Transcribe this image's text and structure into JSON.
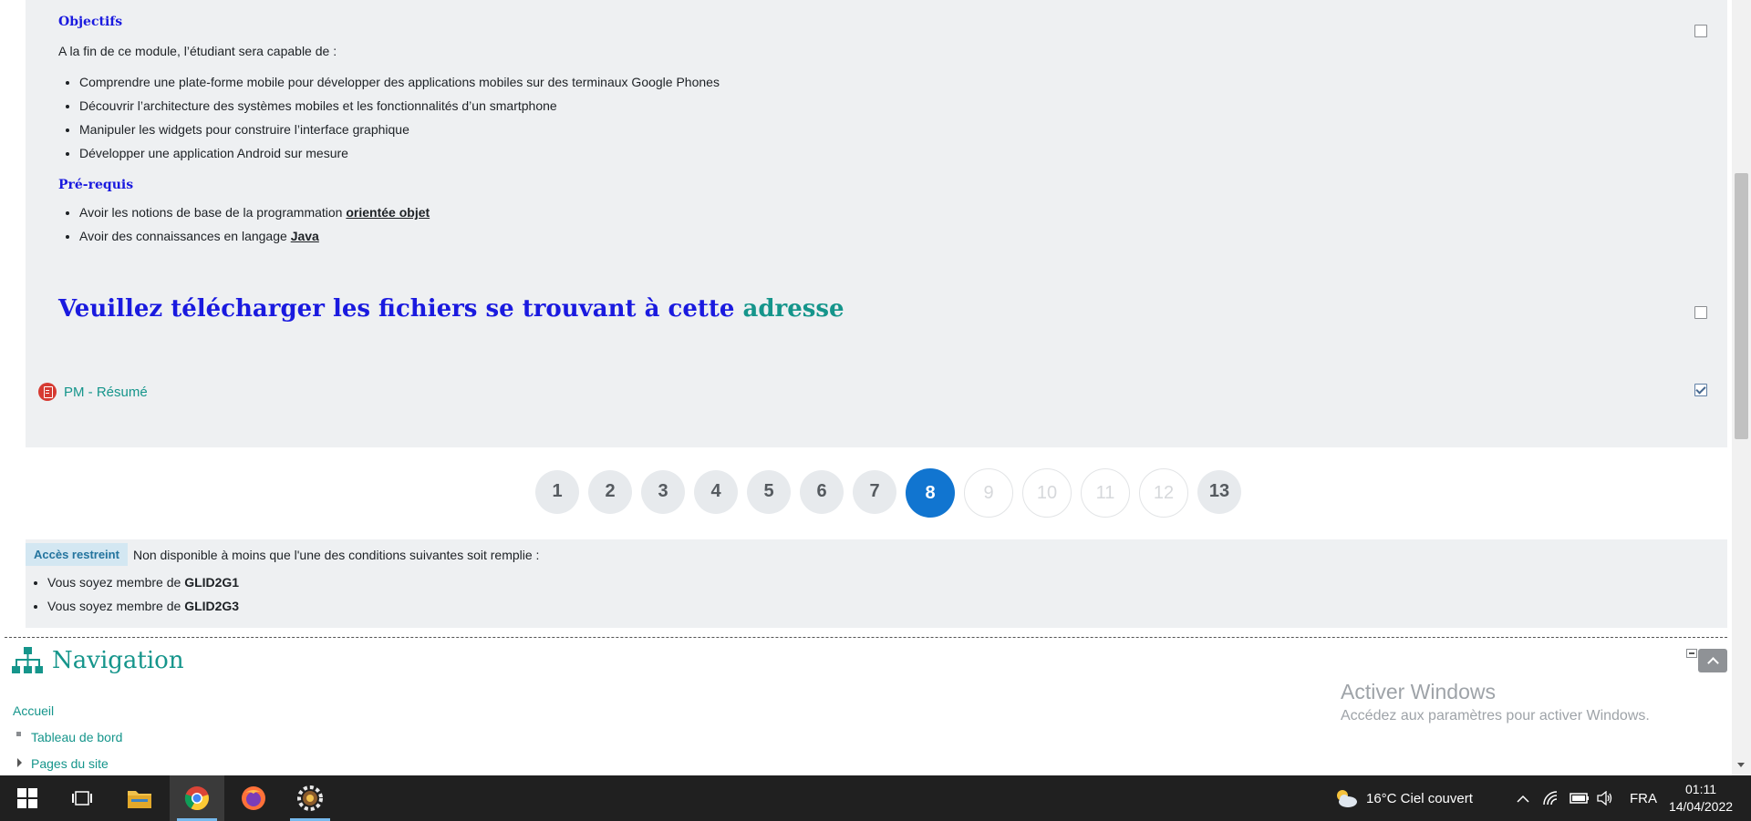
{
  "section": {
    "objectives_title": "Objectifs",
    "intro": "A la fin de ce module, l’étudiant sera capable de :",
    "objectives": [
      "Comprendre une plate-forme mobile pour développer des applications mobiles sur des terminaux Google Phones",
      "Découvrir l’architecture des systèmes mobiles et les fonctionnalités d’un smartphone",
      "Manipuler les widgets pour construire l’interface graphique",
      "Développer une application Android sur mesure"
    ],
    "prereq_title": "Pré-requis",
    "prereq_1_text": "Avoir les notions de base de la programmation ",
    "prereq_1_link": "orientée objet",
    "prereq_2_text": "Avoir des connaissances en langage ",
    "prereq_2_link": "Java",
    "download_text": "Veuillez télécharger les fichiers se trouvant à cette ",
    "download_link": "adresse",
    "resource_label": "PM - Résumé",
    "completion": [
      false,
      false,
      true
    ]
  },
  "pagination": {
    "pages": [
      "1",
      "2",
      "3",
      "4",
      "5",
      "6",
      "7",
      "8",
      "9",
      "10",
      "11",
      "12",
      "13"
    ],
    "current": "8",
    "disabled": [
      "9",
      "10",
      "11",
      "12"
    ]
  },
  "restricted": {
    "badge": "Accès restreint",
    "text": "Non disponible à moins que l'une des conditions suivantes soit remplie :",
    "condition_prefix": "Vous soyez membre de ",
    "groups": [
      "GLID2G1",
      "GLID2G3"
    ]
  },
  "navigation": {
    "title": "Navigation",
    "home": "Accueil",
    "dashboard": "Tableau de bord",
    "site_pages": "Pages du site"
  },
  "watermark": {
    "title": "Activer Windows",
    "subtitle": "Accédez aux paramètres pour activer Windows."
  },
  "taskbar": {
    "weather": "16°C  Ciel couvert",
    "language": "FRA",
    "time": "01:11",
    "date": "14/04/2022"
  },
  "colors": {
    "accent_teal": "#15958b",
    "heading_blue": "#1a1adf",
    "active_page": "#1175d0",
    "card_background": "#eef0f2"
  }
}
